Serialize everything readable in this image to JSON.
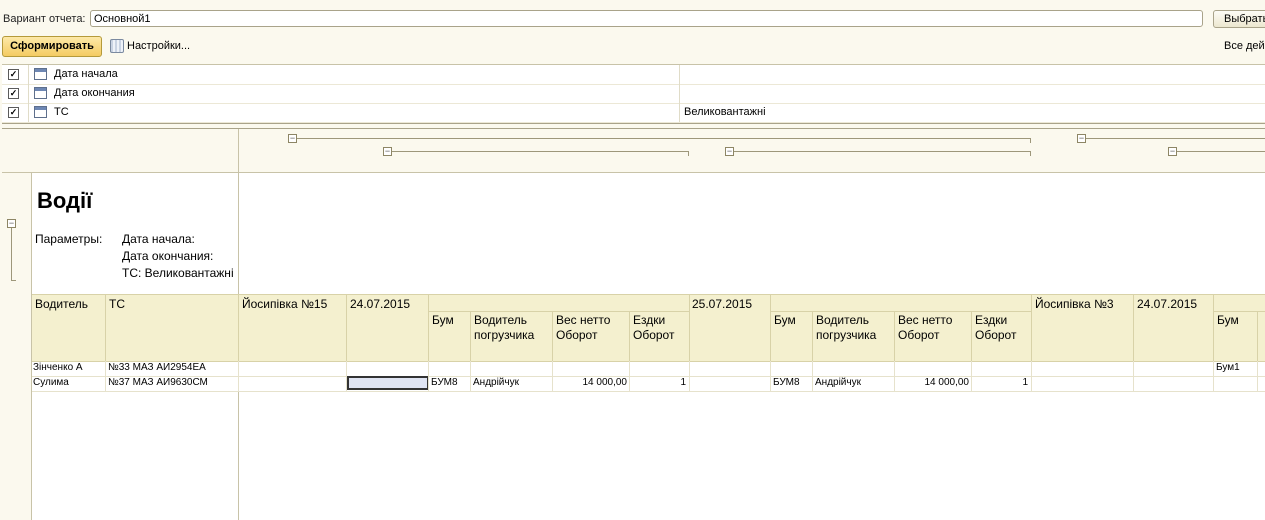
{
  "toolbar": {
    "variant_label": "Вариант отчета:",
    "variant_value": "Основной1",
    "pick_button": "Выбрать",
    "generate_button": "Сформировать",
    "settings_button": "Настройки...",
    "all_actions": "Все действия"
  },
  "params": [
    {
      "checked": true,
      "name": "Дата начала",
      "value": ""
    },
    {
      "checked": true,
      "name": "Дата окончания",
      "value": ""
    },
    {
      "checked": true,
      "name": "ТС",
      "value": "Великовантажні"
    }
  ],
  "report": {
    "title": "Водії",
    "params_label": "Параметры:",
    "param_lines": [
      "Дата начала:",
      "Дата окончания:",
      "ТС: Великовантажні"
    ],
    "headers": {
      "driver": "Водитель",
      "vehicle": "ТС",
      "group1": "Йосипівка №15",
      "date1": "24.07.2015",
      "date2": "25.07.2015",
      "group2": "Йосипівка №3",
      "date3": "24.07.2015",
      "bum": "Бум",
      "loader_driver_1": "Водитель",
      "loader_driver_2": "погрузчика",
      "net_weight_1": "Вес нетто",
      "net_weight_2": "Оборот",
      "trips_1": "Ездки",
      "trips_2": "Оборот"
    },
    "rows": [
      {
        "driver": "Зінченко А",
        "vehicle": "№33 МАЗ АИ2954ЕА",
        "bum1": "",
        "loader1": "",
        "weight1": "",
        "trips1": "",
        "bum2": "",
        "loader2": "",
        "weight2": "",
        "trips2": "",
        "bum3": "Бум1"
      },
      {
        "driver": "Сулима",
        "vehicle": "№37 МАЗ АИ9630СМ",
        "bum1": "БУМ8",
        "loader1": "Андрійчук",
        "weight1": "14 000,00",
        "trips1": "1",
        "bum2": "БУМ8",
        "loader2": "Андрійчук",
        "weight2": "14 000,00",
        "trips2": "1",
        "bum3": ""
      }
    ]
  }
}
